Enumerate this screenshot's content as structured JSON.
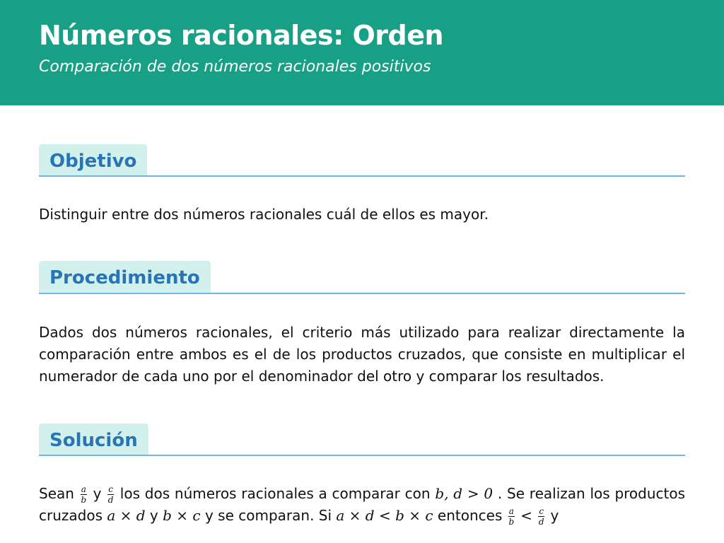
{
  "header": {
    "title": "Números racionales: Orden",
    "subtitle": "Comparación de dos números racionales positivos"
  },
  "sections": {
    "objetivo": {
      "title": "Objetivo",
      "text": "Distinguir entre dos números racionales cuál de ellos es mayor."
    },
    "procedimiento": {
      "title": "Procedimiento",
      "text": "Dados dos números racionales, el criterio más utilizado para realizar directamente la comparación entre ambos es el de los productos cruzados, que consiste en multiplicar el numerador de cada uno por el denominador del otro y comparar los resultados."
    },
    "solucion": {
      "title": "Solución",
      "t1": "Sean",
      "frac1_num": "a",
      "frac1_den": "b",
      "t2": "y",
      "frac2_num": "c",
      "frac2_den": "d",
      "t3": "los dos números racionales a comparar con",
      "m1": "b, d > 0",
      "t4": ". Se realizan los productos cruzados",
      "m2": "a × d",
      "t5": "y",
      "m3": "b × c",
      "t6": "y se comparan. Si",
      "m4": "a × d < b × c",
      "t7": "entonces",
      "frac3_num": "a",
      "frac3_den": "b",
      "m5": "<",
      "frac4_num": "c",
      "frac4_den": "d",
      "t8": "y"
    }
  }
}
